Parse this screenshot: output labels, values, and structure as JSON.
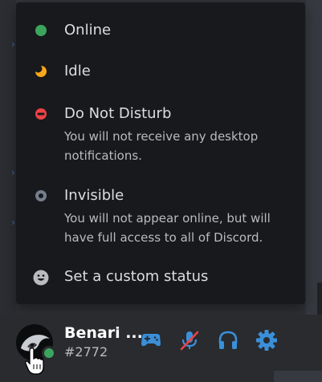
{
  "status_menu": {
    "items": [
      {
        "title": "Online",
        "description": "",
        "icon": "online-status-icon",
        "color": "#3ba55d"
      },
      {
        "title": "Idle",
        "description": "",
        "icon": "idle-moon-icon",
        "color": "#faa81a"
      },
      {
        "title": "Do Not Disturb",
        "description": "You will not receive any desktop notifications.",
        "icon": "do-not-disturb-icon",
        "color": "#ed4245"
      },
      {
        "title": "Invisible",
        "description": "You will not appear online, but will have full access to all of Discord.",
        "icon": "invisible-status-icon",
        "color": "#747f8d"
      },
      {
        "title": "Set a custom status",
        "description": "",
        "icon": "emoji-smile-icon",
        "color": "#b9bbbe"
      }
    ]
  },
  "user_panel": {
    "username": "Benari ...",
    "tag": "#2772",
    "status_color": "#3ba55d",
    "controls": [
      {
        "icon": "gamepad-icon",
        "color": "#3b8fd9"
      },
      {
        "icon": "microphone-muted-icon",
        "color": "#3b8fd9"
      },
      {
        "icon": "headphones-icon",
        "color": "#3b8fd9"
      },
      {
        "icon": "gear-icon",
        "color": "#3b8fd9"
      }
    ]
  }
}
